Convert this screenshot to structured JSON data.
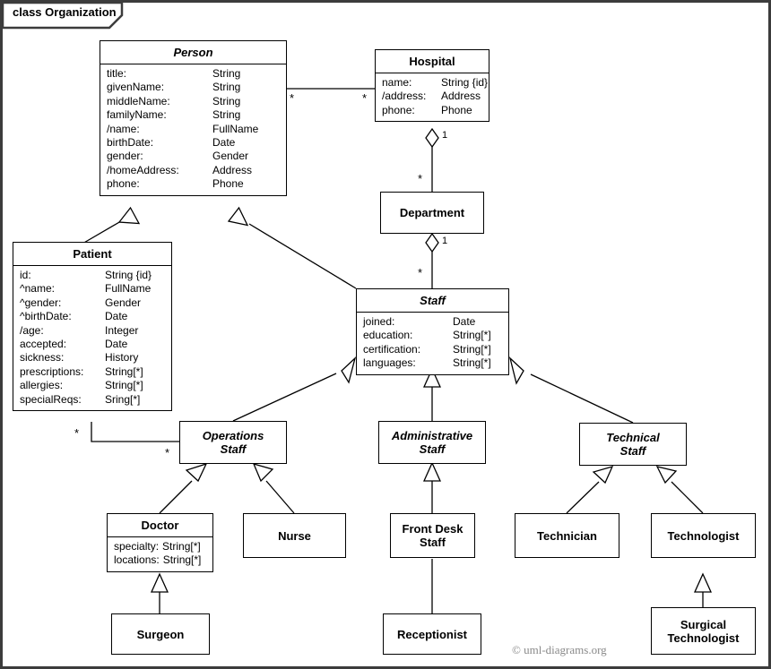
{
  "frame": {
    "label": "class Organization",
    "copyright": "© uml-diagrams.org"
  },
  "classes": {
    "person": {
      "name": "Person",
      "abstract": true,
      "attributes": [
        {
          "name": "title:",
          "type": "String"
        },
        {
          "name": "givenName:",
          "type": "String"
        },
        {
          "name": "middleName:",
          "type": "String"
        },
        {
          "name": "familyName:",
          "type": "String"
        },
        {
          "name": "/name:",
          "type": "FullName"
        },
        {
          "name": "birthDate:",
          "type": "Date"
        },
        {
          "name": "gender:",
          "type": "Gender"
        },
        {
          "name": "/homeAddress:",
          "type": "Address"
        },
        {
          "name": "phone:",
          "type": "Phone"
        }
      ]
    },
    "hospital": {
      "name": "Hospital",
      "abstract": false,
      "attributes": [
        {
          "name": "name:",
          "type": "String {id}"
        },
        {
          "name": "/address:",
          "type": "Address"
        },
        {
          "name": "phone:",
          "type": "Phone"
        }
      ]
    },
    "department": {
      "name": "Department",
      "abstract": false,
      "attributes": []
    },
    "patient": {
      "name": "Patient",
      "abstract": false,
      "attributes": [
        {
          "name": "id:",
          "type": "String {id}"
        },
        {
          "name": "^name:",
          "type": "FullName"
        },
        {
          "name": "^gender:",
          "type": "Gender"
        },
        {
          "name": "^birthDate:",
          "type": "Date"
        },
        {
          "name": "/age:",
          "type": "Integer"
        },
        {
          "name": "accepted:",
          "type": "Date"
        },
        {
          "name": "sickness:",
          "type": "History"
        },
        {
          "name": "prescriptions:",
          "type": "String[*]"
        },
        {
          "name": "allergies:",
          "type": "String[*]"
        },
        {
          "name": "specialReqs:",
          "type": "Sring[*]"
        }
      ]
    },
    "staff": {
      "name": "Staff",
      "abstract": true,
      "attributes": [
        {
          "name": "joined:",
          "type": "Date"
        },
        {
          "name": "education:",
          "type": "String[*]"
        },
        {
          "name": "certification:",
          "type": "String[*]"
        },
        {
          "name": "languages:",
          "type": "String[*]"
        }
      ]
    },
    "operations_staff": {
      "name": "Operations\nStaff",
      "abstract": true,
      "attributes": []
    },
    "administrative_staff": {
      "name": "Administrative\nStaff",
      "abstract": true,
      "attributes": []
    },
    "technical_staff": {
      "name": "Technical\nStaff",
      "abstract": true,
      "attributes": []
    },
    "doctor": {
      "name": "Doctor",
      "abstract": false,
      "attributes": [
        {
          "name": "specialty:",
          "type": "String[*]"
        },
        {
          "name": "locations:",
          "type": "String[*]"
        }
      ]
    },
    "nurse": {
      "name": "Nurse",
      "abstract": false,
      "attributes": []
    },
    "front_desk_staff": {
      "name": "Front Desk\nStaff",
      "abstract": false,
      "attributes": []
    },
    "technician": {
      "name": "Technician",
      "abstract": false,
      "attributes": []
    },
    "technologist": {
      "name": "Technologist",
      "abstract": false,
      "attributes": []
    },
    "surgeon": {
      "name": "Surgeon",
      "abstract": false,
      "attributes": []
    },
    "receptionist": {
      "name": "Receptionist",
      "abstract": false,
      "attributes": []
    },
    "surgical_technologist": {
      "name": "Surgical\nTechnologist",
      "abstract": false,
      "attributes": []
    }
  },
  "multiplicities": [
    {
      "id": "person-hospital-person-end",
      "value": "*"
    },
    {
      "id": "person-hospital-hospital-end",
      "value": "*"
    },
    {
      "id": "hospital-department-hospital-end",
      "value": "1"
    },
    {
      "id": "hospital-department-department-end",
      "value": "*"
    },
    {
      "id": "department-staff-department-end",
      "value": "1"
    },
    {
      "id": "department-staff-staff-end",
      "value": "*"
    },
    {
      "id": "patient-operations-patient-end",
      "value": "*"
    },
    {
      "id": "patient-operations-operations-end",
      "value": "*"
    }
  ]
}
